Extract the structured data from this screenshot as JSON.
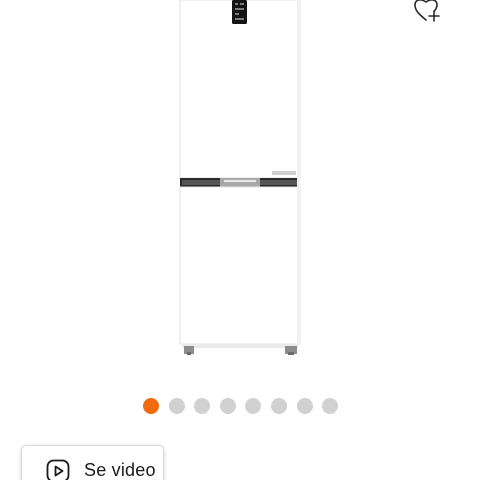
{
  "product": {
    "image": "white-bottom-freezer-fridge",
    "wishlist_icon": "heart-plus-icon"
  },
  "carousel": {
    "total": 8,
    "current": 1,
    "active_color": "#f26a10",
    "inactive_color": "#d1d1d1"
  },
  "video_button": {
    "label": "Se video",
    "icon": "play-icon"
  }
}
